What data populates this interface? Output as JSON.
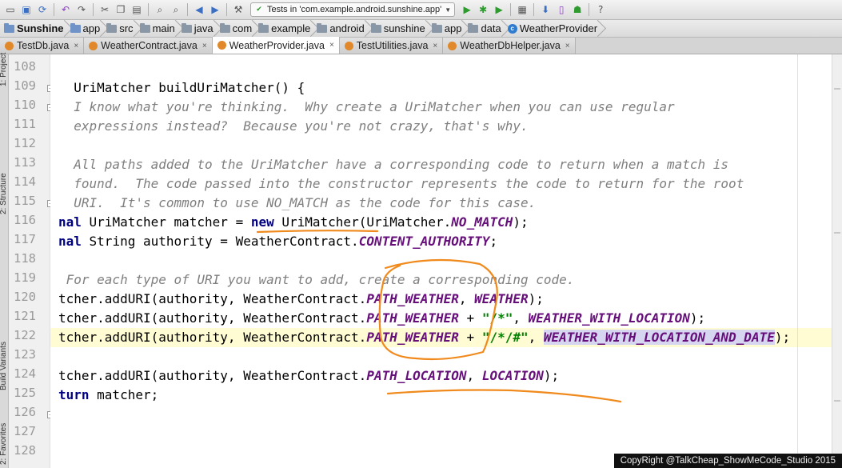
{
  "toolbar": {
    "run_config": "Tests in 'com.example.android.sunshine.app'",
    "icons": [
      "folder-open-icon",
      "save-icon",
      "sync-icon",
      "undo-icon",
      "redo-icon",
      "cut-icon",
      "copy-icon",
      "paste-icon",
      "find-icon",
      "replace-icon",
      "back-icon",
      "forward-icon",
      "build-icon",
      "run-icon",
      "debug-icon",
      "coverage-icon",
      "project-structure-icon",
      "sdk-manager-icon",
      "avd-manager-icon",
      "android-icon",
      "help-icon"
    ]
  },
  "breadcrumb": [
    "Sunshine",
    "app",
    "src",
    "main",
    "java",
    "com",
    "example",
    "android",
    "sunshine",
    "app",
    "data",
    "WeatherProvider"
  ],
  "tabs": [
    {
      "label": "TestDb.java",
      "active": false
    },
    {
      "label": "WeatherContract.java",
      "active": false
    },
    {
      "label": "WeatherProvider.java",
      "active": true
    },
    {
      "label": "TestUtilities.java",
      "active": false
    },
    {
      "label": "WeatherDbHelper.java",
      "active": false
    }
  ],
  "side_tools": [
    "1: Project",
    "2: Structure",
    "Build Variants",
    "2: Favorites"
  ],
  "editor": {
    "line_numbers": [
      "108",
      "109",
      "110",
      "111",
      "112",
      "113",
      "114",
      "115",
      "116",
      "117",
      "118",
      "119",
      "120",
      "121",
      "122",
      "123",
      "124",
      "125",
      "126",
      "127",
      "128"
    ],
    "current_line": "122",
    "lines": [
      [],
      [
        {
          "t": "  UriMatcher buildUriMatcher() {",
          "c": ""
        }
      ],
      [
        {
          "t": "  I know what you're thinking.  Why create a UriMatcher when you can use regular",
          "c": "cm"
        }
      ],
      [
        {
          "t": "  expressions instead?  Because you're not crazy, that's why.",
          "c": "cm"
        }
      ],
      [],
      [
        {
          "t": "  All paths added to the UriMatcher have a corresponding code to return when a match is",
          "c": "cm"
        }
      ],
      [
        {
          "t": "  found.  The code passed into the constructor represents the code to return for the root",
          "c": "cm"
        }
      ],
      [
        {
          "t": "  URI.  It's common to use NO_MATCH as the code for this case.",
          "c": "cm"
        }
      ],
      [
        {
          "t": "nal",
          "c": "kw"
        },
        {
          "t": " UriMatcher matcher = ",
          "c": ""
        },
        {
          "t": "new",
          "c": "kw"
        },
        {
          "t": " UriMatcher(UriMatcher.",
          "c": ""
        },
        {
          "t": "NO_MATCH",
          "c": "fld"
        },
        {
          "t": ");",
          "c": ""
        }
      ],
      [
        {
          "t": "nal",
          "c": "kw"
        },
        {
          "t": " String authority = WeatherContract.",
          "c": ""
        },
        {
          "t": "CONTENT_AUTHORITY",
          "c": "fld"
        },
        {
          "t": ";",
          "c": ""
        }
      ],
      [],
      [
        {
          "t": " For each type of URI you want to add, create a corresponding code.",
          "c": "cm"
        }
      ],
      [
        {
          "t": "tcher.addURI(authority, WeatherContract.",
          "c": ""
        },
        {
          "t": "PATH_WEATHER",
          "c": "fld"
        },
        {
          "t": ", ",
          "c": ""
        },
        {
          "t": "WEATHER",
          "c": "fld"
        },
        {
          "t": ");",
          "c": ""
        }
      ],
      [
        {
          "t": "tcher.addURI(authority, WeatherContract.",
          "c": ""
        },
        {
          "t": "PATH_WEATHER",
          "c": "fld"
        },
        {
          "t": " + ",
          "c": ""
        },
        {
          "t": "\"/*\"",
          "c": "str"
        },
        {
          "t": ", ",
          "c": ""
        },
        {
          "t": "WEATHER_WITH_LOCATION",
          "c": "fld"
        },
        {
          "t": ");",
          "c": ""
        }
      ],
      [
        {
          "t": "tcher.addURI(authority, WeatherContract.",
          "c": ""
        },
        {
          "t": "PATH_WEATHER",
          "c": "fld"
        },
        {
          "t": " + ",
          "c": ""
        },
        {
          "t": "\"/*/#\"",
          "c": "str"
        },
        {
          "t": ", ",
          "c": ""
        },
        {
          "t": "WEATHER_WITH_LOCATION_AND_DATE",
          "c": "fld sel"
        },
        {
          "t": ");",
          "c": ""
        }
      ],
      [],
      [
        {
          "t": "tcher.addURI(authority, WeatherContract.",
          "c": ""
        },
        {
          "t": "PATH_LOCATION",
          "c": "fld"
        },
        {
          "t": ", ",
          "c": ""
        },
        {
          "t": "LOCATION",
          "c": "fld"
        },
        {
          "t": ");",
          "c": ""
        }
      ],
      [
        {
          "t": "turn",
          "c": "kw"
        },
        {
          "t": " matcher;",
          "c": ""
        }
      ],
      [],
      [],
      []
    ]
  },
  "copyright": "CopyRight @TalkCheap_ShowMeCode_Studio 2015",
  "colors": {
    "keyword": "#000080",
    "field": "#660e7a",
    "string": "#008000",
    "comment": "#7f7f7f",
    "annotation": "#f08a1c",
    "current_line": "#fffbd2"
  }
}
